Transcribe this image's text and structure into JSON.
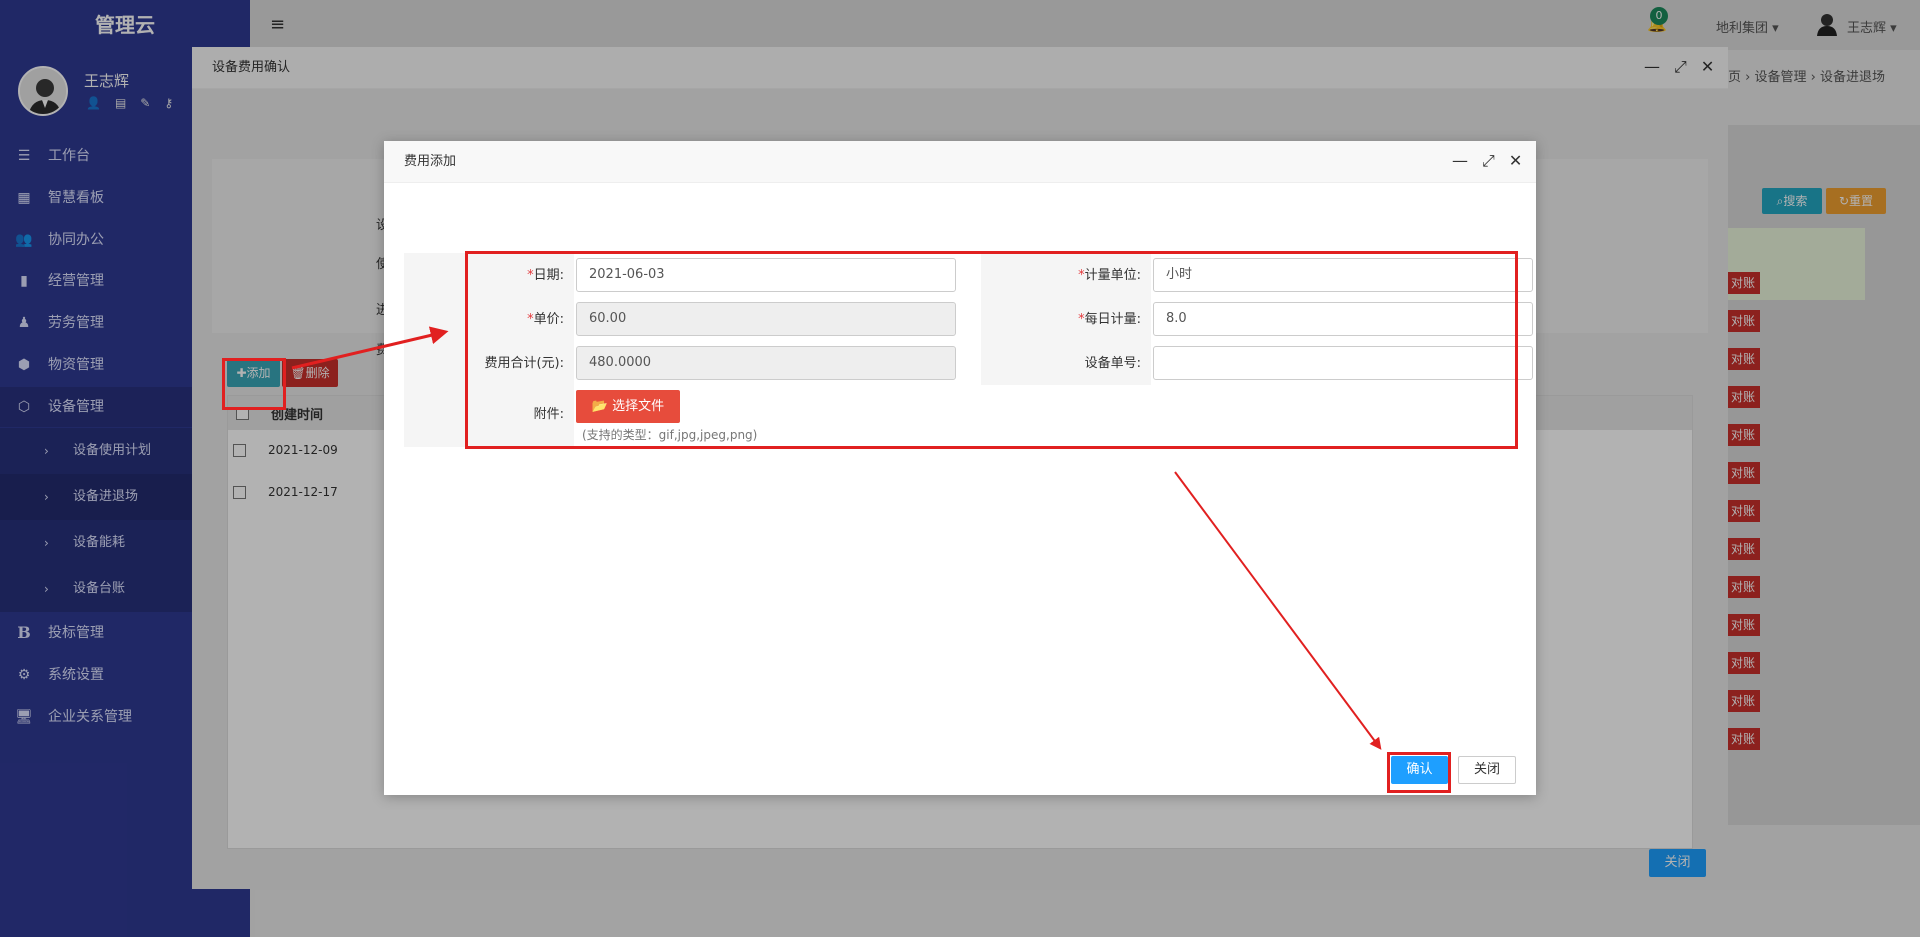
{
  "sidebar": {
    "brand": "管理云",
    "user_name": "王志辉",
    "user_icons": [
      "user-icon",
      "card-icon",
      "edit-icon",
      "key-icon"
    ],
    "items": [
      {
        "label": "工作台",
        "icon": "list-icon"
      },
      {
        "label": "智慧看板",
        "icon": "dashboard-icon"
      },
      {
        "label": "协同办公",
        "icon": "users-icon"
      },
      {
        "label": "经营管理",
        "icon": "bar-chart-icon"
      },
      {
        "label": "劳务管理",
        "icon": "worker-icon"
      },
      {
        "label": "物资管理",
        "icon": "cube-icon"
      },
      {
        "label": "设备管理",
        "icon": "cubes-icon"
      },
      {
        "label": "投标管理",
        "icon": "bold-b-icon"
      },
      {
        "label": "系统设置",
        "icon": "gear-icon"
      },
      {
        "label": "企业关系管理",
        "icon": "monitor-icon"
      }
    ],
    "sub_items": [
      "设备使用计划",
      "设备进退场",
      "设备能耗",
      "设备台账"
    ]
  },
  "topbar": {
    "notification_count": "0",
    "org": "地利集团",
    "user": "王志辉",
    "breadcrumb": [
      "页",
      "设备管理",
      "设备进退场"
    ]
  },
  "background_page": {
    "search_label": "搜索",
    "reset_label": "重置",
    "row_action": "对账"
  },
  "outer_modal": {
    "title": "设备费用确认",
    "add_label": "添加",
    "delete_label": "删除",
    "table_header": "创建时间",
    "rows": [
      "2021-12-09",
      "2021-12-17"
    ],
    "close_label": "关闭",
    "label_fragments": [
      "设",
      "使",
      "进",
      "费"
    ]
  },
  "inner_modal": {
    "title": "费用添加",
    "fields": {
      "date_label": "日期:",
      "date_value": "2021-06-03",
      "unit_price_label": "单价:",
      "unit_price_value": "60.00",
      "total_label": "费用合计(元):",
      "total_value": "480.0000",
      "attachment_label": "附件:",
      "choose_file_label": "选择文件",
      "file_types_hint": "(支持的类型：gif,jpg,jpeg,png)",
      "measure_unit_label": "计量单位:",
      "measure_unit_value": "小时",
      "daily_amount_label": "每日计量:",
      "daily_amount_value": "8.0",
      "equipment_no_label": "设备单号:",
      "equipment_no_value": ""
    },
    "confirm_label": "确认",
    "close_label": "关闭"
  },
  "colors": {
    "sidebar": "#2f3a93",
    "primary": "#1e9fff",
    "danger": "#e74c3c",
    "annotation": "#e12020"
  }
}
